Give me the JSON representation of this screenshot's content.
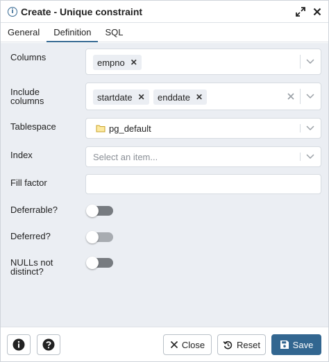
{
  "dialog": {
    "title": "Create - Unique constraint",
    "tabs": [
      {
        "label": "General"
      },
      {
        "label": "Definition"
      },
      {
        "label": "SQL"
      }
    ]
  },
  "form": {
    "columns": {
      "label": "Columns",
      "chips": [
        "empno"
      ]
    },
    "include_columns": {
      "label_line1": "Include",
      "label_line2": "columns",
      "chips": [
        "startdate",
        "enddate"
      ]
    },
    "tablespace": {
      "label": "Tablespace",
      "value": "pg_default"
    },
    "index": {
      "label": "Index",
      "placeholder": "Select an item..."
    },
    "fill_factor": {
      "label": "Fill factor",
      "value": ""
    },
    "deferrable": {
      "label": "Deferrable?",
      "on": false
    },
    "deferred": {
      "label": "Deferred?",
      "on": false
    },
    "nulls_not_distinct": {
      "label_line1": "NULLs not",
      "label_line2": "distinct?",
      "on": false
    }
  },
  "footer": {
    "close_label": "Close",
    "reset_label": "Reset",
    "save_label": "Save"
  },
  "icons": {
    "title": "info-icon",
    "expand": "expand-icon",
    "close": "close-icon",
    "folder": "folder-icon"
  },
  "colors": {
    "accent": "#326690",
    "panel_bg": "#ebeef3"
  }
}
